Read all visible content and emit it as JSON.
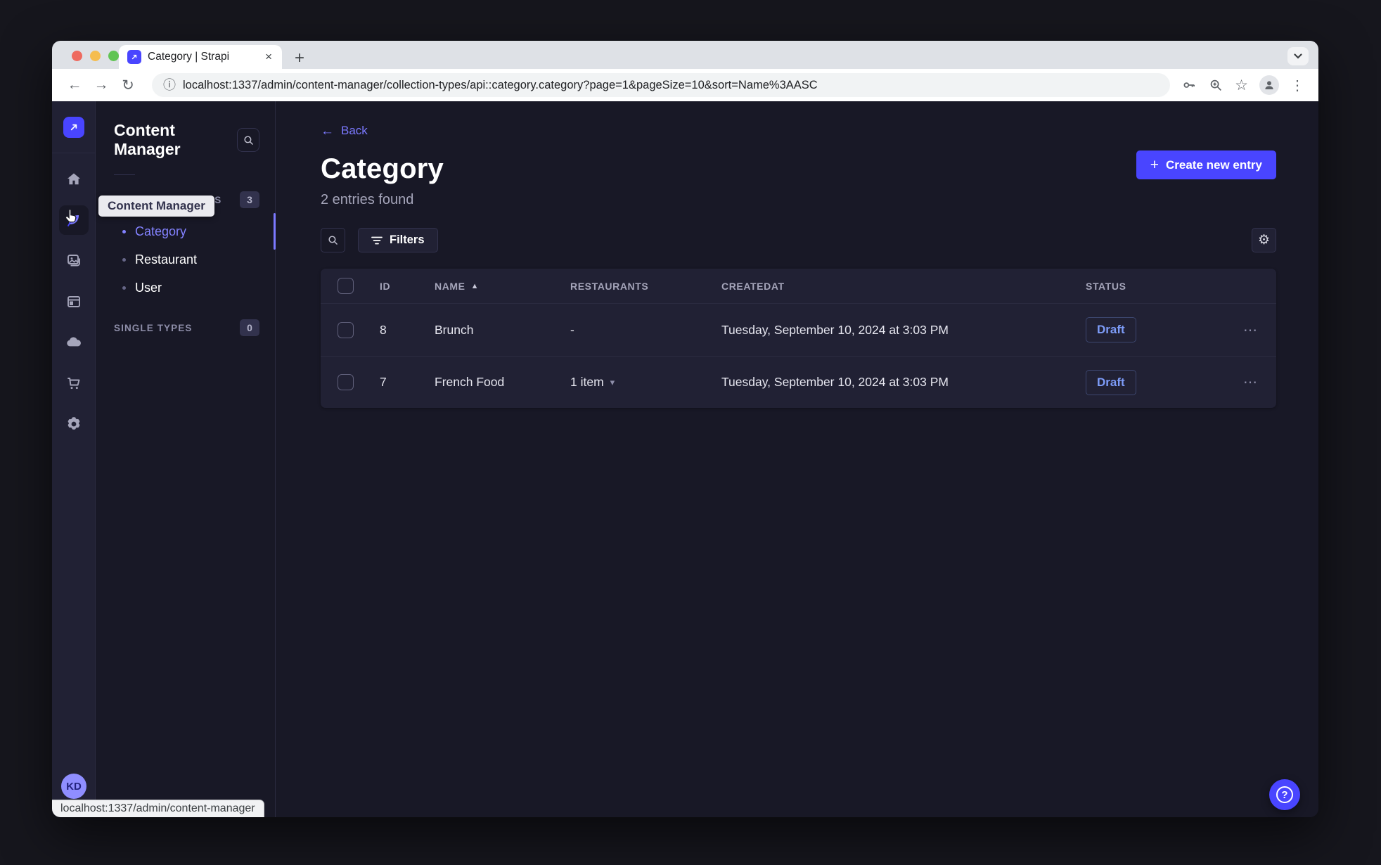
{
  "browser": {
    "tab_title": "Category | Strapi",
    "url": "localhost:1337/admin/content-manager/collection-types/api::category.category?page=1&pageSize=10&sort=Name%3AASC",
    "status_link": "localhost:1337/admin/content-manager"
  },
  "icons": {
    "back_arrow": "←",
    "forward_arrow": "→",
    "reload": "↻",
    "info": "ⓘ",
    "star": "☆",
    "kebab_v": "⋮",
    "kebab_h": "⋯",
    "close": "×",
    "plus": "+",
    "sort_asc": "▲",
    "caret_down": "▾",
    "gear": "⚙",
    "question": "?"
  },
  "rail": {
    "tooltip": "Content Manager",
    "avatar_initials": "KD"
  },
  "subnav": {
    "title": "Content Manager",
    "sections": [
      {
        "label": "COLLECTION TYPES",
        "badge": "3"
      },
      {
        "label": "SINGLE TYPES",
        "badge": "0"
      }
    ],
    "items": [
      {
        "label": "Category",
        "active": true
      },
      {
        "label": "Restaurant",
        "active": false
      },
      {
        "label": "User",
        "active": false
      }
    ]
  },
  "main": {
    "back_label": "Back",
    "title": "Category",
    "subtitle": "2 entries found",
    "create_button": "Create new entry",
    "filters_button": "Filters"
  },
  "table": {
    "headers": [
      "ID",
      "NAME",
      "RESTAURANTS",
      "CREATEDAT",
      "STATUS"
    ],
    "rows": [
      {
        "id": "8",
        "name": "Brunch",
        "restaurants": "-",
        "created_at": "Tuesday, September 10, 2024 at 3:03 PM",
        "status": "Draft"
      },
      {
        "id": "7",
        "name": "French Food",
        "restaurants": "1 item",
        "created_at": "Tuesday, September 10, 2024 at 3:03 PM",
        "status": "Draft"
      }
    ]
  },
  "colors": {
    "primary": "#4945ff",
    "primary_light": "#7b79ff",
    "surface": "#212134",
    "background": "#181826",
    "draft_text": "#7d9cf8"
  }
}
